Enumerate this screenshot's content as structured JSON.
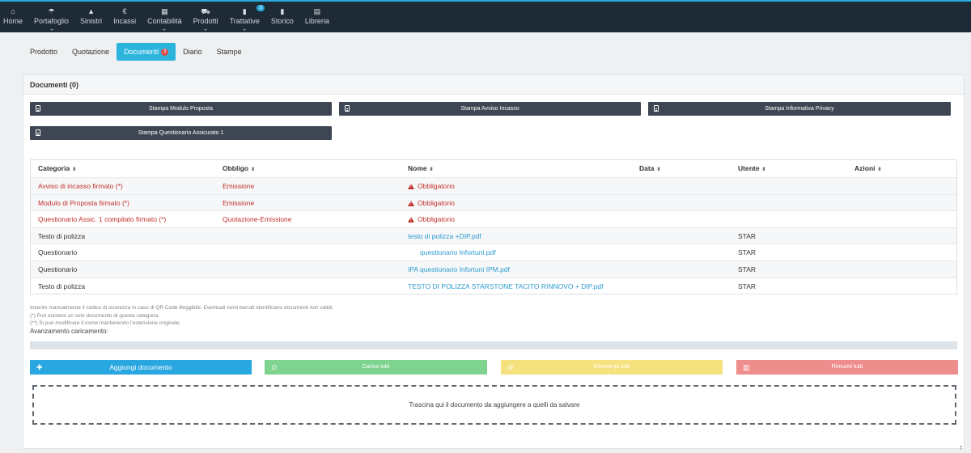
{
  "nav": [
    {
      "label": "Home",
      "icon": "home-icon",
      "glyph": "⌂",
      "caret": false,
      "badge": ""
    },
    {
      "label": "Portafoglio",
      "icon": "umbrella-icon",
      "glyph": "☂",
      "caret": true,
      "badge": ""
    },
    {
      "label": "Sinistri",
      "icon": "warning-icon",
      "glyph": "▲",
      "caret": false,
      "badge": ""
    },
    {
      "label": "Incassi",
      "icon": "euro-icon",
      "glyph": "€",
      "caret": false,
      "badge": ""
    },
    {
      "label": "Contabilità",
      "icon": "calculator-icon",
      "glyph": "▦",
      "caret": true,
      "badge": ""
    },
    {
      "label": "Prodotti",
      "icon": "cart-icon",
      "glyph": "⛟",
      "caret": true,
      "badge": ""
    },
    {
      "label": "Trattative",
      "icon": "bar-chart-icon",
      "glyph": "▮",
      "caret": true,
      "badge": "3"
    },
    {
      "label": "Storico",
      "icon": "history-chart-icon",
      "glyph": "▮",
      "caret": false,
      "badge": ""
    },
    {
      "label": "Libreria",
      "icon": "book-icon",
      "glyph": "▤",
      "caret": false,
      "badge": ""
    }
  ],
  "tabs": {
    "prodotto": "Prodotto",
    "quotazione": "Quotazione",
    "documenti": "Documenti",
    "documenti_badge": "3",
    "diario": "Diario",
    "stampe": "Stampe"
  },
  "panel": {
    "title": "Documenti (0)"
  },
  "print_buttons": {
    "modulo_proposta": "Stampa Modulo Proposta",
    "avviso_incasso": "Stampa Avviso Incasso",
    "informativa_privacy": "Stampa Informativa Privacy",
    "questionario": "Stampa Questionario Assicurato 1"
  },
  "table": {
    "headers": {
      "categoria": "Categoria",
      "obbligo": "Obbligo",
      "nome": "Nome",
      "data": "Data",
      "utente": "Utente",
      "azioni": "Azioni"
    },
    "rows": [
      {
        "categoria": "Avviso di incasso firmato (*)",
        "obbligo": "Emissione",
        "nome": "Obbligatorio",
        "data": "",
        "utente": ""
      },
      {
        "categoria": "Modulo di Proposta firmato (*)",
        "obbligo": "Emissione",
        "nome": "Obbligatorio",
        "data": "",
        "utente": ""
      },
      {
        "categoria": "Questionario Assic. 1 compilato firmato (*)",
        "obbligo": "Quotazione-Emissione",
        "nome": "Obbligatorio",
        "data": "",
        "utente": ""
      },
      {
        "categoria": "Testo di polizza",
        "obbligo": "",
        "nome": "testo di polizza +DIP.pdf",
        "data": "",
        "utente": "STAR"
      },
      {
        "categoria": "Questionario",
        "obbligo": "",
        "nome": "questionario Infortuni.pdf",
        "data": "",
        "utente": "STAR"
      },
      {
        "categoria": "Questionario",
        "obbligo": "",
        "nome": "IPA questionario Infortuni IPM.pdf",
        "data": "",
        "utente": "STAR"
      },
      {
        "categoria": "Testo di polizza",
        "obbligo": "",
        "nome": "TESTO DI POLIZZA STARSTONE TACITO RINNOVO + DIP.pdf",
        "data": "",
        "utente": "STAR"
      }
    ]
  },
  "notes": {
    "line1": "Inserire manualmente il codice di sicurezza in caso di QR Code illeggibile. Eventuali nomi barrati identificano documenti non validi.",
    "line2": "(*) Può esistere un solo documento di questa categoria.",
    "line3": "(**) Si può modificare il nome mantenendo l'estensione originale."
  },
  "progress": {
    "label": "Avanzamento caricamento:",
    "value": 0
  },
  "actions": {
    "add": "Aggiungi documento",
    "load_all": "Carica tutti",
    "stop_all": "Interrompi tutti",
    "remove_all": "Rimuovi tutti"
  },
  "dropzone": {
    "text": "Trascina qui il documento da aggiungere a quelli da salvare"
  },
  "colors": {
    "nav_bg": "#1e2a36",
    "accent": "#2aa7dc",
    "required_red": "#c0302b",
    "link_blue": "#2a9bd1"
  }
}
